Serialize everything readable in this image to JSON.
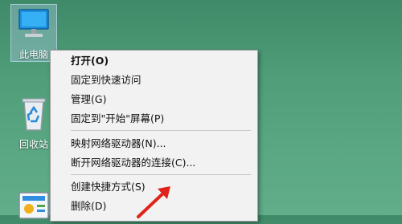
{
  "desktop": {
    "icons": [
      {
        "label": "此电脑",
        "icon": "this-pc-icon"
      },
      {
        "label": "回收站",
        "icon": "recycle-bin-icon"
      },
      {
        "label": "",
        "icon": "control-panel-icon"
      }
    ]
  },
  "context_menu": {
    "items": [
      {
        "label": "打开(O)"
      },
      {
        "label": "固定到快速访问"
      },
      {
        "label": "管理(G)"
      },
      {
        "label": "固定到\"开始\"屏幕(P)"
      },
      {
        "label": "映射网络驱动器(N)..."
      },
      {
        "label": "断开网络驱动器的连接(C)..."
      },
      {
        "label": "创建快捷方式(S)"
      },
      {
        "label": "删除(D)"
      }
    ]
  },
  "colors": {
    "desktop_bg": "#4f9d79",
    "menu_bg": "#f2f2f2",
    "annotation_arrow": "#e0241c"
  }
}
